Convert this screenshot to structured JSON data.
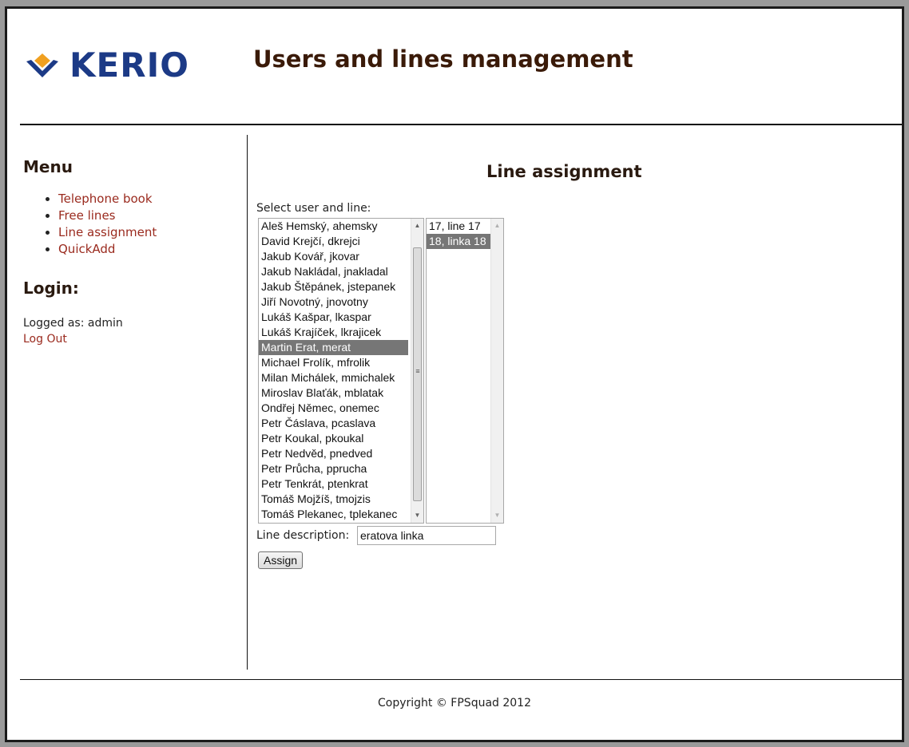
{
  "header": {
    "logo_text": "KERIO",
    "title": "Users and lines management",
    "brand_color": "#1c3a86"
  },
  "sidebar": {
    "menu_heading": "Menu",
    "menu_items": [
      {
        "label": "Telephone book"
      },
      {
        "label": "Free lines"
      },
      {
        "label": "Line assignment"
      },
      {
        "label": "QuickAdd"
      }
    ],
    "login_heading": "Login:",
    "logged_as": "Logged as: admin",
    "logout_label": "Log Out",
    "link_color": "#9a2a1e"
  },
  "main": {
    "section_title": "Line assignment",
    "select_label": "Select user and line:",
    "users": [
      {
        "label": "Aleš Hemský, ahemsky"
      },
      {
        "label": "David Krejčí, dkrejci"
      },
      {
        "label": "Jakub Kovář, jkovar"
      },
      {
        "label": "Jakub Nakládal, jnakladal"
      },
      {
        "label": "Jakub Štěpánek, jstepanek"
      },
      {
        "label": "Jiří Novotný, jnovotny"
      },
      {
        "label": "Lukáš Kašpar, lkaspar"
      },
      {
        "label": "Lukáš Krajíček, lkrajicek"
      },
      {
        "label": "Martin Erat, merat",
        "selected": true
      },
      {
        "label": "Michael Frolík, mfrolik"
      },
      {
        "label": "Milan Michálek, mmichalek"
      },
      {
        "label": "Miroslav Blaťák, mblatak"
      },
      {
        "label": "Ondřej Němec, onemec"
      },
      {
        "label": "Petr Čáslava, pcaslava"
      },
      {
        "label": "Petr Koukal, pkoukal"
      },
      {
        "label": "Petr Nedvěd, pnedved"
      },
      {
        "label": "Petr Průcha, pprucha"
      },
      {
        "label": "Petr Tenkrát, ptenkrat"
      },
      {
        "label": "Tomáš Mojžíš, tmojzis"
      },
      {
        "label": "Tomáš Plekanec, tplekanec"
      }
    ],
    "lines": [
      {
        "label": "17, line 17"
      },
      {
        "label": "18, linka 18",
        "selected": true
      }
    ],
    "description_label": "Line description:",
    "description_value": "eratova linka",
    "assign_label": "Assign",
    "selected_color": "#767676"
  },
  "footer": {
    "copyright": "Copyright © FPSquad 2012"
  }
}
